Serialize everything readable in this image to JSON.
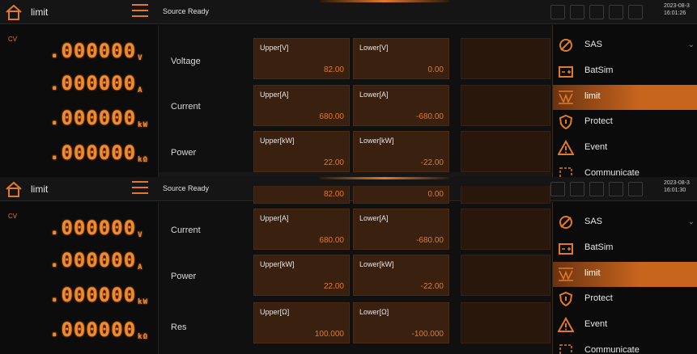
{
  "screens": [
    {
      "title": "limit",
      "status": "Source Ready",
      "date": "2023-08-3",
      "time": "16:01:26",
      "mode": "CV",
      "readings": [
        {
          "value": ".000000",
          "unit": "V"
        },
        {
          "value": ".000000",
          "unit": "A"
        },
        {
          "value": ".000000",
          "unit": "kW"
        },
        {
          "value": ".000000",
          "unit": "kΩ"
        }
      ],
      "rows": [
        {
          "label": "Voltage",
          "upper_label": "Upper[V]",
          "upper_value": "82.00",
          "lower_label": "Lower[V]",
          "lower_value": "0.00"
        },
        {
          "label": "Current",
          "upper_label": "Upper[A]",
          "upper_value": "680.00",
          "lower_label": "Lower[A]",
          "lower_value": "-680.00"
        },
        {
          "label": "Power",
          "upper_label": "Upper[kW]",
          "upper_value": "22.00",
          "lower_label": "Lower[kW]",
          "lower_value": "-22.00"
        }
      ],
      "menu": [
        {
          "label": "SAS",
          "icon": "sas-icon"
        },
        {
          "label": "BatSim",
          "icon": "battery-icon"
        },
        {
          "label": "limit",
          "icon": "limit-icon",
          "active": true
        },
        {
          "label": "Protect",
          "icon": "shield-icon"
        },
        {
          "label": "Event",
          "icon": "warning-icon"
        },
        {
          "label": "Communicate",
          "icon": "communicate-icon"
        }
      ]
    },
    {
      "title": "limit",
      "status": "Source Ready",
      "date": "2023-08-3",
      "time": "16:01:30",
      "mode": "CV",
      "readings": [
        {
          "value": ".000000",
          "unit": "V"
        },
        {
          "value": ".000000",
          "unit": "A"
        },
        {
          "value": ".000000",
          "unit": "kW"
        },
        {
          "value": ".000000",
          "unit": "kΩ"
        }
      ],
      "partial_row": {
        "upper_value": "82.00",
        "lower_value": "0.00"
      },
      "rows": [
        {
          "label": "Current",
          "upper_label": "Upper[A]",
          "upper_value": "680.00",
          "lower_label": "Lower[A]",
          "lower_value": "-680.00"
        },
        {
          "label": "Power",
          "upper_label": "Upper[kW]",
          "upper_value": "22.00",
          "lower_label": "Lower[kW]",
          "lower_value": "-22.00"
        },
        {
          "label": "Res",
          "upper_label": "Upper[Ω]",
          "upper_value": "100.000",
          "lower_label": "Lower[Ω]",
          "lower_value": "-100.000"
        }
      ],
      "menu": [
        {
          "label": "SAS",
          "icon": "sas-icon"
        },
        {
          "label": "BatSim",
          "icon": "battery-icon"
        },
        {
          "label": "limit",
          "icon": "limit-icon",
          "active": true
        },
        {
          "label": "Protect",
          "icon": "shield-icon"
        },
        {
          "label": "Event",
          "icon": "warning-icon"
        },
        {
          "label": "Communicate",
          "icon": "communicate-icon"
        }
      ]
    }
  ],
  "colors": {
    "accent": "#e07a2a",
    "panel": "#3a200f",
    "background": "#0a0a0a"
  }
}
